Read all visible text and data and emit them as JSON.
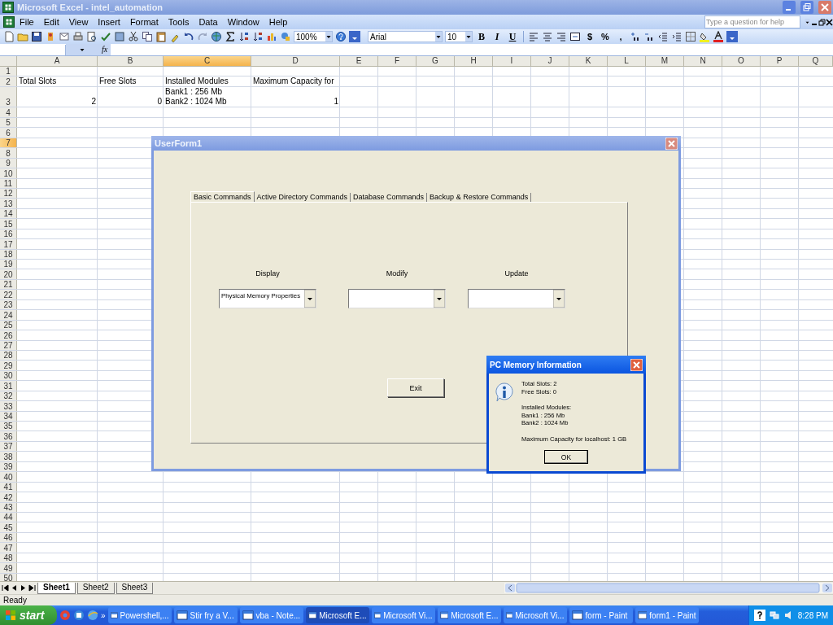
{
  "window": {
    "title": "Microsoft Excel - intel_automation"
  },
  "menu": [
    "File",
    "Edit",
    "View",
    "Insert",
    "Format",
    "Tools",
    "Data",
    "Window",
    "Help"
  ],
  "help_box": {
    "placeholder": "Type a question for help"
  },
  "toolbar": {
    "zoom": "100%",
    "font": "Arial",
    "font_size": "10",
    "style_buttons": [
      "B",
      "I",
      "U"
    ],
    "number_buttons": [
      "$",
      "%",
      ","
    ]
  },
  "formula_bar": {
    "function_label": "fx"
  },
  "sheet": {
    "columns": [
      {
        "label": "A",
        "selected": false
      },
      {
        "label": "B",
        "selected": false
      },
      {
        "label": "C",
        "selected": true
      },
      {
        "label": "D",
        "selected": false
      },
      {
        "label": "E",
        "selected": false
      },
      {
        "label": "F",
        "selected": false
      },
      {
        "label": "G",
        "selected": false
      },
      {
        "label": "H",
        "selected": false
      },
      {
        "label": "I",
        "selected": false
      },
      {
        "label": "J",
        "selected": false
      },
      {
        "label": "K",
        "selected": false
      },
      {
        "label": "L",
        "selected": false
      },
      {
        "label": "M",
        "selected": false
      },
      {
        "label": "N",
        "selected": false
      },
      {
        "label": "O",
        "selected": false
      },
      {
        "label": "P",
        "selected": false
      },
      {
        "label": "Q",
        "selected": false
      }
    ],
    "rows": [
      {
        "label": "1",
        "selected": false
      },
      {
        "label": "2",
        "selected": false,
        "cells": [
          {
            "kind": "text",
            "lines": [
              "Total Slots"
            ]
          },
          {
            "kind": "text",
            "lines": [
              "Free Slots"
            ]
          },
          {
            "kind": "text",
            "lines": [
              "Installed Modules"
            ]
          },
          {
            "kind": "text",
            "lines": [
              "Maximum Capacity for"
            ]
          }
        ]
      },
      {
        "label": "3",
        "selected": false,
        "cells": [
          {
            "kind": "number",
            "lines": [
              "2"
            ]
          },
          {
            "kind": "number",
            "lines": [
              "0"
            ]
          },
          {
            "kind": "text",
            "lines": [
              "Bank1 : 256 Mb",
              "Bank2 : 1024 Mb"
            ]
          },
          {
            "kind": "number",
            "lines": [
              "1"
            ]
          }
        ]
      },
      {
        "label": "4",
        "selected": false
      },
      {
        "label": "5",
        "selected": false
      },
      {
        "label": "6",
        "selected": false
      },
      {
        "label": "7",
        "selected": true
      },
      {
        "label": "8",
        "selected": false
      },
      {
        "label": "9",
        "selected": false
      },
      {
        "label": "10",
        "selected": false
      },
      {
        "label": "11",
        "selected": false
      },
      {
        "label": "12",
        "selected": false
      },
      {
        "label": "13",
        "selected": false
      },
      {
        "label": "14",
        "selected": false
      },
      {
        "label": "15",
        "selected": false
      },
      {
        "label": "16",
        "selected": false
      },
      {
        "label": "17",
        "selected": false
      },
      {
        "label": "18",
        "selected": false
      },
      {
        "label": "19",
        "selected": false
      },
      {
        "label": "20",
        "selected": false
      },
      {
        "label": "21",
        "selected": false
      },
      {
        "label": "22",
        "selected": false
      },
      {
        "label": "23",
        "selected": false
      },
      {
        "label": "24",
        "selected": false
      },
      {
        "label": "25",
        "selected": false
      },
      {
        "label": "26",
        "selected": false
      },
      {
        "label": "27",
        "selected": false
      },
      {
        "label": "28",
        "selected": false
      },
      {
        "label": "29",
        "selected": false
      },
      {
        "label": "30",
        "selected": false
      },
      {
        "label": "31",
        "selected": false
      },
      {
        "label": "32",
        "selected": false
      },
      {
        "label": "33",
        "selected": false
      },
      {
        "label": "34",
        "selected": false
      },
      {
        "label": "35",
        "selected": false
      },
      {
        "label": "36",
        "selected": false
      },
      {
        "label": "37",
        "selected": false
      },
      {
        "label": "38",
        "selected": false
      },
      {
        "label": "39",
        "selected": false
      },
      {
        "label": "40",
        "selected": false
      },
      {
        "label": "41",
        "selected": false
      },
      {
        "label": "42",
        "selected": false
      },
      {
        "label": "43",
        "selected": false
      },
      {
        "label": "44",
        "selected": false
      },
      {
        "label": "45",
        "selected": false
      },
      {
        "label": "46",
        "selected": false
      },
      {
        "label": "47",
        "selected": false
      },
      {
        "label": "48",
        "selected": false
      },
      {
        "label": "49",
        "selected": false
      },
      {
        "label": "50",
        "selected": false
      }
    ]
  },
  "sheet_tabs": [
    {
      "label": "Sheet1",
      "selected": true
    },
    {
      "label": "Sheet2",
      "selected": false
    },
    {
      "label": "Sheet3",
      "selected": false
    }
  ],
  "status_bar": {
    "text": "Ready"
  },
  "userform": {
    "title": "UserForm1",
    "tabs": [
      {
        "label": "Basic Commands",
        "selected": true
      },
      {
        "label": "Active Directory Commands",
        "selected": false
      },
      {
        "label": "Database Commands",
        "selected": false
      },
      {
        "label": "Backup & Restore Commands",
        "selected": false
      }
    ],
    "groups": [
      {
        "label": "Display",
        "value": "Physical Memory Properties"
      },
      {
        "label": "Modify"
      },
      {
        "label": "Update"
      }
    ],
    "exit_button": "Exit"
  },
  "message_box": {
    "title": "PC Memory Information",
    "paragraphs": [
      [
        "Total Slots: 2",
        "Free Slots: 0"
      ],
      [
        "Installed Modules:",
        "Bank1 : 256 Mb",
        "Bank2 : 1024 Mb"
      ],
      [
        "Maximum Capacity for localhost: 1 GB"
      ]
    ],
    "button": "OK"
  },
  "taskbar": {
    "start": "start",
    "overflow": "»",
    "tasks": [
      {
        "label": "Powershell,...",
        "selected": false
      },
      {
        "label": "Stir fry a V...",
        "selected": false
      },
      {
        "label": "vba - Note...",
        "selected": false
      },
      {
        "label": "Microsoft E...",
        "selected": true
      },
      {
        "label": "Microsoft Vi...",
        "selected": false
      },
      {
        "label": "Microsoft E...",
        "selected": false
      },
      {
        "label": "Microsoft Vi...",
        "selected": false
      },
      {
        "label": "form - Paint",
        "selected": false
      },
      {
        "label": "form1 - Paint",
        "selected": false
      }
    ],
    "clock": "8:28 PM"
  }
}
